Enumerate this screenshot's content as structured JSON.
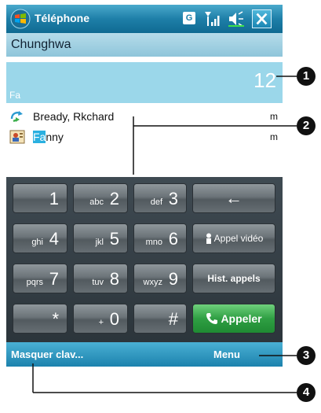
{
  "titlebar": {
    "title": "Téléphone",
    "g_label": "G"
  },
  "carrier": {
    "name": "Chunghwa"
  },
  "display": {
    "number": "12",
    "filter": "Fa"
  },
  "contacts": [
    {
      "name": "Bready, Rkchard",
      "type": "m"
    },
    {
      "name_highlight": "Fa",
      "name_rest": "nny",
      "type": "m"
    }
  ],
  "keypad": {
    "keys": [
      {
        "digit": "1",
        "letters": ""
      },
      {
        "digit": "2",
        "letters": "abc"
      },
      {
        "digit": "3",
        "letters": "def"
      },
      {
        "digit": "4",
        "letters": "ghi"
      },
      {
        "digit": "5",
        "letters": "jkl"
      },
      {
        "digit": "6",
        "letters": "mno"
      },
      {
        "digit": "7",
        "letters": "pqrs"
      },
      {
        "digit": "8",
        "letters": "tuv"
      },
      {
        "digit": "9",
        "letters": "wxyz"
      },
      {
        "digit": "*",
        "letters": ""
      },
      {
        "digit": "0",
        "letters": "+"
      },
      {
        "digit": "#",
        "letters": ""
      }
    ],
    "backspace": "←",
    "video_call": "Appel vidéo",
    "call_history": "Hist. appels",
    "call": "Appeler"
  },
  "menubar": {
    "left": "Masquer clav...",
    "right": "Menu"
  },
  "callouts": {
    "c1": "1",
    "c2": "2",
    "c3": "3",
    "c4": "4"
  },
  "colors": {
    "titlebar": "#1e7fa8",
    "display": "#9bd7ea",
    "call_green": "#2f9f43",
    "keypad_bg": "#343d43"
  }
}
